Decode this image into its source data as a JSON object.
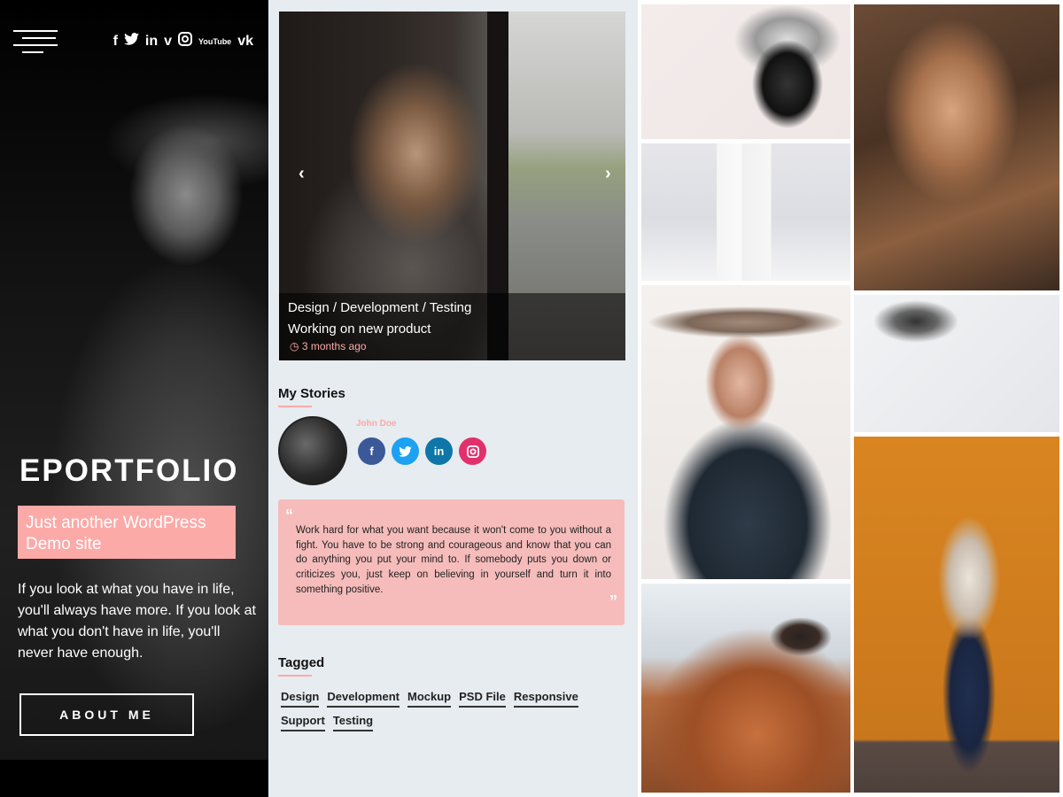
{
  "header": {
    "social_icons": [
      "f",
      "t",
      "in",
      "v",
      "ig",
      "YouTube",
      "vk"
    ]
  },
  "sidebar": {
    "site_title": "EPORTFOLIO",
    "tagline": "Just another WordPress Demo site",
    "intro": "If you look at what you have in life, you'll always have more. If you look at what you don't have in life, you'll never have enough.",
    "about_button": "ABOUT ME"
  },
  "slider": {
    "categories": [
      "Design",
      "/ Development",
      "/ Testing"
    ],
    "post_title": "Working on new product",
    "post_date": "3 months ago",
    "prev_arrow": "‹",
    "next_arrow": "›"
  },
  "stories": {
    "heading": "My Stories",
    "author_name": "John Doe",
    "author_socials": [
      "f",
      "t",
      "in",
      "ig"
    ],
    "quote": "Work hard for what you want because it won't come to you without a fight. You have to be strong and courageous and know that you can do anything you put your mind to. If somebody puts you down or criticizes you, just keep on believing in yourself and turn it into something positive."
  },
  "tagged": {
    "heading": "Tagged",
    "tags": [
      "Design",
      "Development",
      "Mockup",
      "PSD File",
      "Responsive",
      "Support",
      "Testing"
    ]
  },
  "colors": {
    "accent_pink": "#fcaaa8",
    "quote_bg": "#f5bcbb",
    "facebook": "#3b5998",
    "twitter": "#1da1f2",
    "linkedin": "#0e76a8",
    "instagram": "#e1306c"
  }
}
